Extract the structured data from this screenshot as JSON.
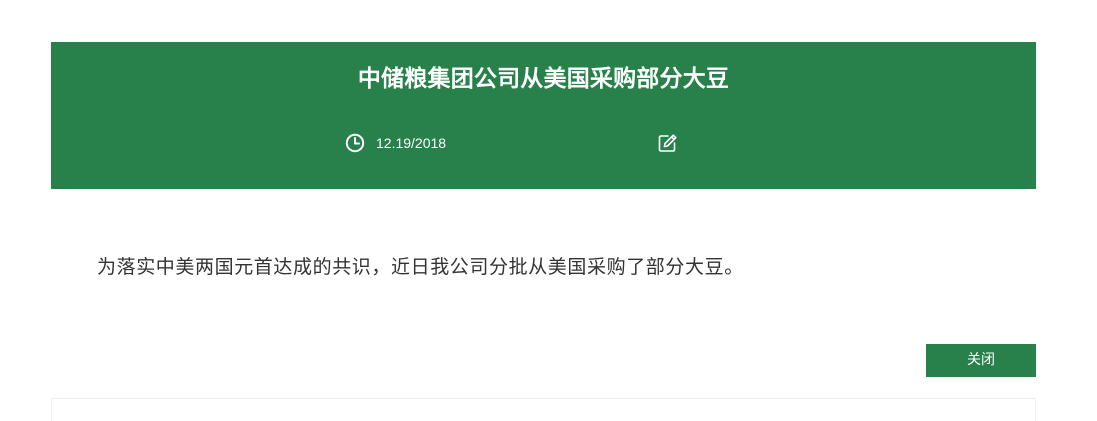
{
  "article": {
    "title": "中储粮集团公司从美国采购部分大豆",
    "date": "12.19/2018",
    "body": "为落实中美两国元首达成的共识，近日我公司分批从美国采购了部分大豆。"
  },
  "actions": {
    "close_label": "关闭"
  },
  "icons": {
    "date": "clock-icon",
    "edit": "edit-icon"
  },
  "colors": {
    "header_bg": "#28804a",
    "button_bg": "#28804a",
    "header_text": "#ffffff",
    "body_text": "#333333"
  }
}
